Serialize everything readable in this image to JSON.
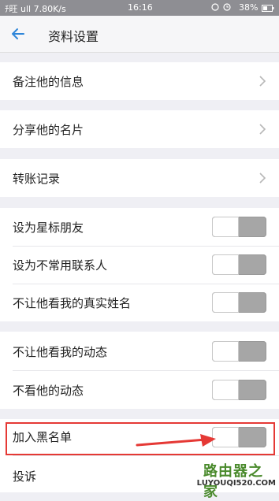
{
  "status_bar": {
    "left_text": "ﾁ旺 ull 7.80K/s",
    "time": "16:16",
    "battery": "38%"
  },
  "header": {
    "title": "资料设置"
  },
  "rows": {
    "remark": "备注他的信息",
    "share_card": "分享他的名片",
    "transfer_records": "转账记录",
    "star_friend": "设为星标朋友",
    "infrequent_contact": "设为不常用联系人",
    "hide_real_name": "不让他看我的真实姓名",
    "hide_my_moments": "不让他看我的动态",
    "hide_his_moments": "不看他的动态",
    "blacklist": "加入黑名单",
    "complain": "投诉"
  },
  "toggles": {
    "star_friend": false,
    "infrequent_contact": false,
    "hide_real_name": false,
    "hide_my_moments": false,
    "hide_his_moments": false,
    "blacklist": false
  },
  "watermark": {
    "title": "路由器之家",
    "url": "LUYOUQI520.COM"
  },
  "colors": {
    "accent": "#2f86d9",
    "annotation": "#e53935",
    "toggle_off": "#a6a6a6"
  }
}
